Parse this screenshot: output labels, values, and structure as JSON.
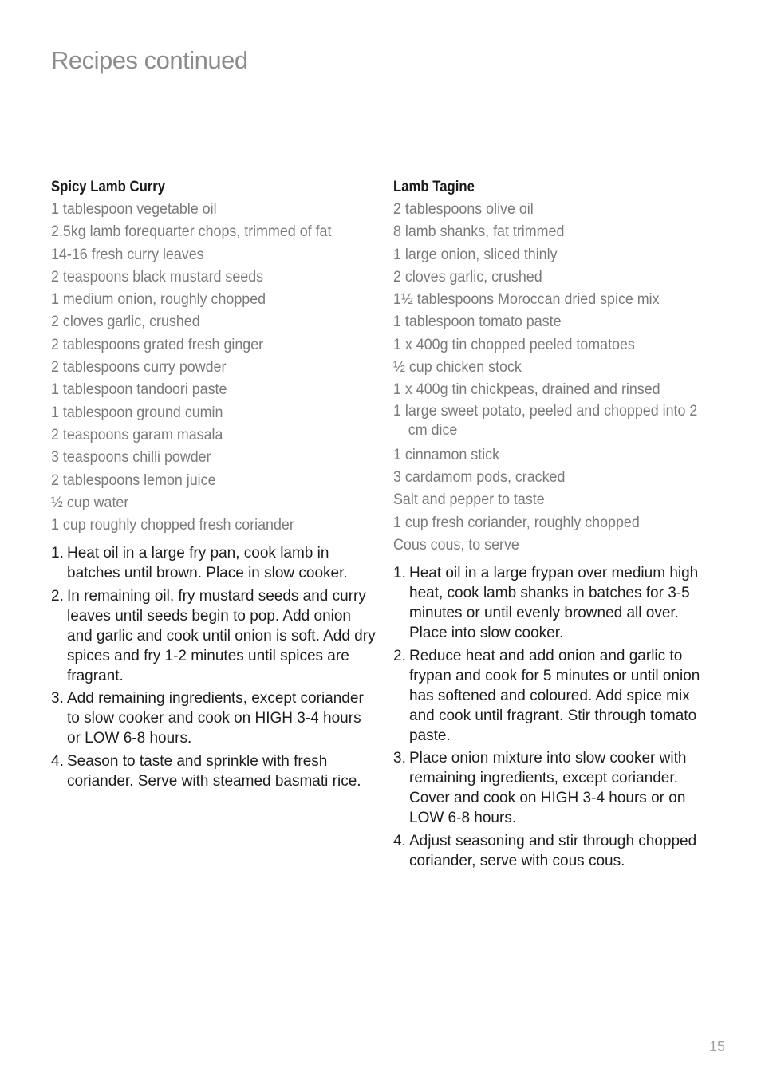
{
  "page": {
    "title": "Recipes continued",
    "page_number": "15"
  },
  "recipes": [
    {
      "title": "Spicy Lamb Curry",
      "ingredients": [
        "1 tablespoon vegetable oil",
        "2.5kg lamb forequarter chops, trimmed of fat",
        "14-16 fresh curry leaves",
        "2 teaspoons black mustard seeds",
        "1 medium onion, roughly chopped",
        "2 cloves garlic, crushed",
        "2 tablespoons grated fresh ginger",
        "2 tablespoons curry powder",
        "1 tablespoon tandoori paste",
        "1 tablespoon ground cumin",
        "2 teaspoons garam masala",
        "3 teaspoons chilli powder",
        "2 tablespoons lemon juice",
        "½ cup water",
        "1 cup roughly chopped fresh coriander"
      ],
      "method": [
        {
          "num": "1.",
          "text": "Heat oil in a large fry pan, cook lamb in batches until brown. Place in slow cooker."
        },
        {
          "num": "2.",
          "text": "In remaining oil, fry mustard seeds and curry leaves until seeds begin to pop. Add onion and garlic and cook until onion is soft. Add dry spices and fry 1-2 minutes until spices are fragrant."
        },
        {
          "num": "3.",
          "text": "Add remaining ingredients, except coriander to slow cooker and cook on HIGH 3-4 hours or LOW 6-8 hours."
        },
        {
          "num": "4.",
          "text": "Season to taste and sprinkle with fresh coriander. Serve with steamed basmati rice."
        }
      ]
    },
    {
      "title": "Lamb Tagine",
      "ingredients": [
        "2 tablespoons olive oil",
        "8 lamb shanks, fat trimmed",
        "1 large onion, sliced thinly",
        "2 cloves garlic, crushed",
        "1½ tablespoons Moroccan dried spice mix",
        "1 tablespoon tomato paste",
        "1 x 400g tin chopped peeled tomatoes",
        "½ cup chicken stock",
        "1 x 400g tin chickpeas, drained and rinsed",
        "1 large sweet potato, peeled and chopped into 2 cm dice",
        "1 cinnamon stick",
        "3 cardamom pods, cracked",
        "Salt and pepper to taste",
        "1 cup fresh coriander, roughly chopped",
        "Cous cous, to serve"
      ],
      "method": [
        {
          "num": "1.",
          "text": "Heat oil in a large frypan over medium high heat, cook lamb shanks in batches for 3-5 minutes or until evenly browned all over. Place into slow cooker."
        },
        {
          "num": "2.",
          "text": "Reduce heat and add onion and garlic to frypan and cook for 5 minutes or until onion has softened and coloured. Add spice mix and cook until fragrant.  Stir through tomato paste."
        },
        {
          "num": "3.",
          "text": "Place onion mixture into slow cooker with remaining ingredients, except coriander. Cover and cook on HIGH 3-4 hours or on LOW 6-8 hours."
        },
        {
          "num": "4.",
          "text": "Adjust seasoning and stir through chopped coriander, serve with cous cous."
        }
      ]
    }
  ]
}
